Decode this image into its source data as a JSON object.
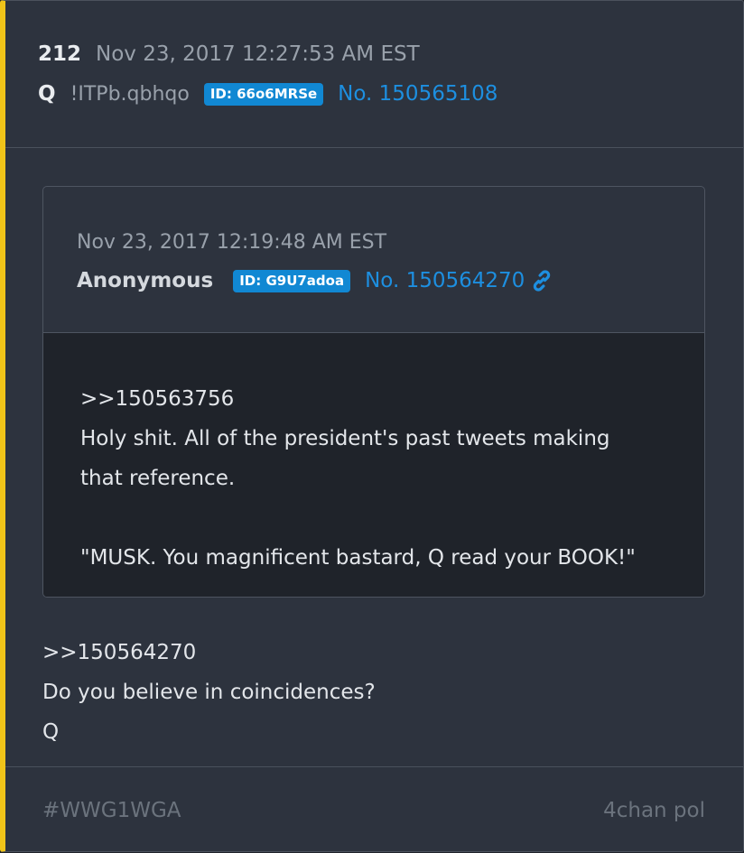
{
  "post": {
    "number": "212",
    "date": "Nov 23, 2017 12:27:53 AM EST",
    "author": "Q",
    "tripcode": "!ITPb.qbhqo",
    "id": "ID: 66o6MRSe",
    "post_no": "No. 150565108"
  },
  "quoted": {
    "date": "Nov 23, 2017 12:19:48 AM EST",
    "author": "Anonymous",
    "id": "ID: G9U7adoa",
    "post_no": "No. 150564270",
    "link_icon": "link-icon",
    "body": {
      "reply_ref": ">>150563756",
      "line1": "Holy shit. All of the president's past tweets making",
      "line2": "that reference.",
      "line3": "\"MUSK. You magnificent bastard, Q read your BOOK!\""
    }
  },
  "message": {
    "reply_ref": ">>150564270",
    "line1": "Do you believe in coincidences?",
    "signature": "Q"
  },
  "footer": {
    "hashtag": "#WWG1WGA",
    "source": "4chan pol"
  },
  "colors": {
    "accent_bar": "#f0c419",
    "badge": "#1188d3",
    "link": "#1d8fe0",
    "card_bg": "#2d333e",
    "body_bg": "#1f232a"
  }
}
